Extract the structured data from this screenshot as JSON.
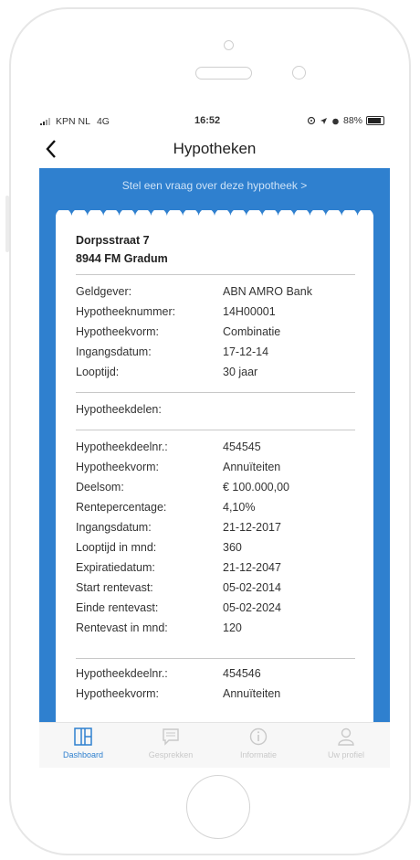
{
  "status_bar": {
    "carrier": "KPN NL",
    "network": "4G",
    "time": "16:52",
    "battery": "88%",
    "battery_level": 0.88
  },
  "header": {
    "title": "Hypotheken",
    "back_icon": "chevron-left-icon"
  },
  "banner": {
    "ask_label": "Stel een vraag over deze hypotheek  >"
  },
  "address": {
    "street": "Dorpsstraat 7",
    "city": "8944 FM Gradum"
  },
  "general": [
    {
      "label": "Geldgever:",
      "value": "ABN AMRO Bank"
    },
    {
      "label": "Hypotheeknummer:",
      "value": "14H00001"
    },
    {
      "label": "Hypotheekvorm:",
      "value": "Combinatie"
    },
    {
      "label": "Ingangsdatum:",
      "value": "17-12-14"
    },
    {
      "label": "Looptijd:",
      "value": "30 jaar"
    }
  ],
  "parts_heading": "Hypotheekdelen:",
  "part1": [
    {
      "label": "Hypotheekdeelnr.:",
      "value": "454545"
    },
    {
      "label": "Hypotheekvorm:",
      "value": "Annuïteiten"
    },
    {
      "label": "Deelsom:",
      "value": "€ 100.000,00"
    },
    {
      "label": "Rentepercentage:",
      "value": "4,10%"
    },
    {
      "label": "Ingangsdatum:",
      "value": "21-12-2017"
    },
    {
      "label": "Looptijd in mnd:",
      "value": "360"
    },
    {
      "label": "Expiratiedatum:",
      "value": "21-12-2047"
    },
    {
      "label": "Start rentevast:",
      "value": "05-02-2014"
    },
    {
      "label": "Einde rentevast:",
      "value": "05-02-2024"
    },
    {
      "label": "Rentevast in mnd:",
      "value": "120"
    }
  ],
  "part2": [
    {
      "label": "Hypotheekdeelnr.:",
      "value": "454546"
    },
    {
      "label": "Hypotheekvorm:",
      "value": "Annuïteiten"
    }
  ],
  "tabs": [
    {
      "label": "Dashboard",
      "icon": "dashboard-icon",
      "active": true
    },
    {
      "label": "Gesprekken",
      "icon": "chat-icon",
      "active": false
    },
    {
      "label": "Informatie",
      "icon": "info-icon",
      "active": false
    },
    {
      "label": "Uw profiel",
      "icon": "profile-icon",
      "active": false
    }
  ],
  "colors": {
    "accent": "#2f80cf",
    "tab_active": "#2f80cf",
    "tab_inactive": "#c9c9c9"
  }
}
